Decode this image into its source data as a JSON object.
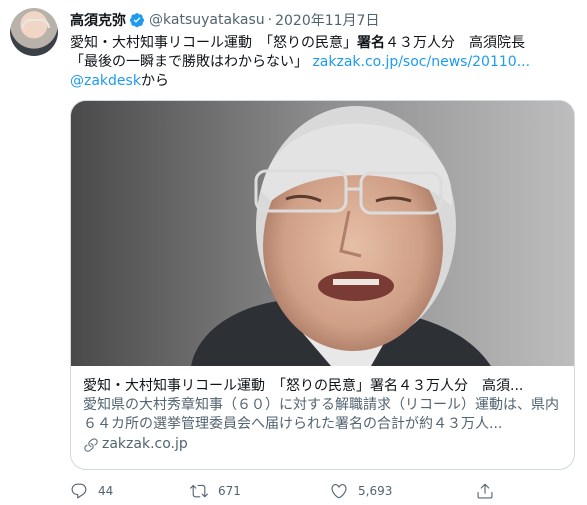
{
  "tweet": {
    "author_name": "高須克弥",
    "handle": "@katsuyatakasu",
    "separator": "·",
    "date": "2020年11月7日",
    "text_line1_a": "愛知・大村知事リコール運動　「怒りの民意」",
    "text_line1_b": "署名",
    "text_line1_c": "４３万人分　高須院長",
    "text_line2_a": "「最後の一瞬まで勝敗はわからない」 ",
    "text_link": "zakzak.co.jp/soc/news/20110...",
    "text_mention": "@zakdesk",
    "text_from": "から"
  },
  "card": {
    "title": "愛知・大村知事リコール運動　「怒りの民意」署名４３万人分　高須...",
    "description": "愛知県の大村秀章知事（６０）に対する解職請求（リコール）運動は、県内６４カ所の選挙管理委員会へ届けられた署名の合計が約４３万人...",
    "domain": "zakzak.co.jp"
  },
  "actions": {
    "replies": "44",
    "retweets": "671",
    "likes": "5,693"
  },
  "colors": {
    "link": "#1d9bf0",
    "secondary_text": "#536471",
    "border": "#cfd9de"
  }
}
